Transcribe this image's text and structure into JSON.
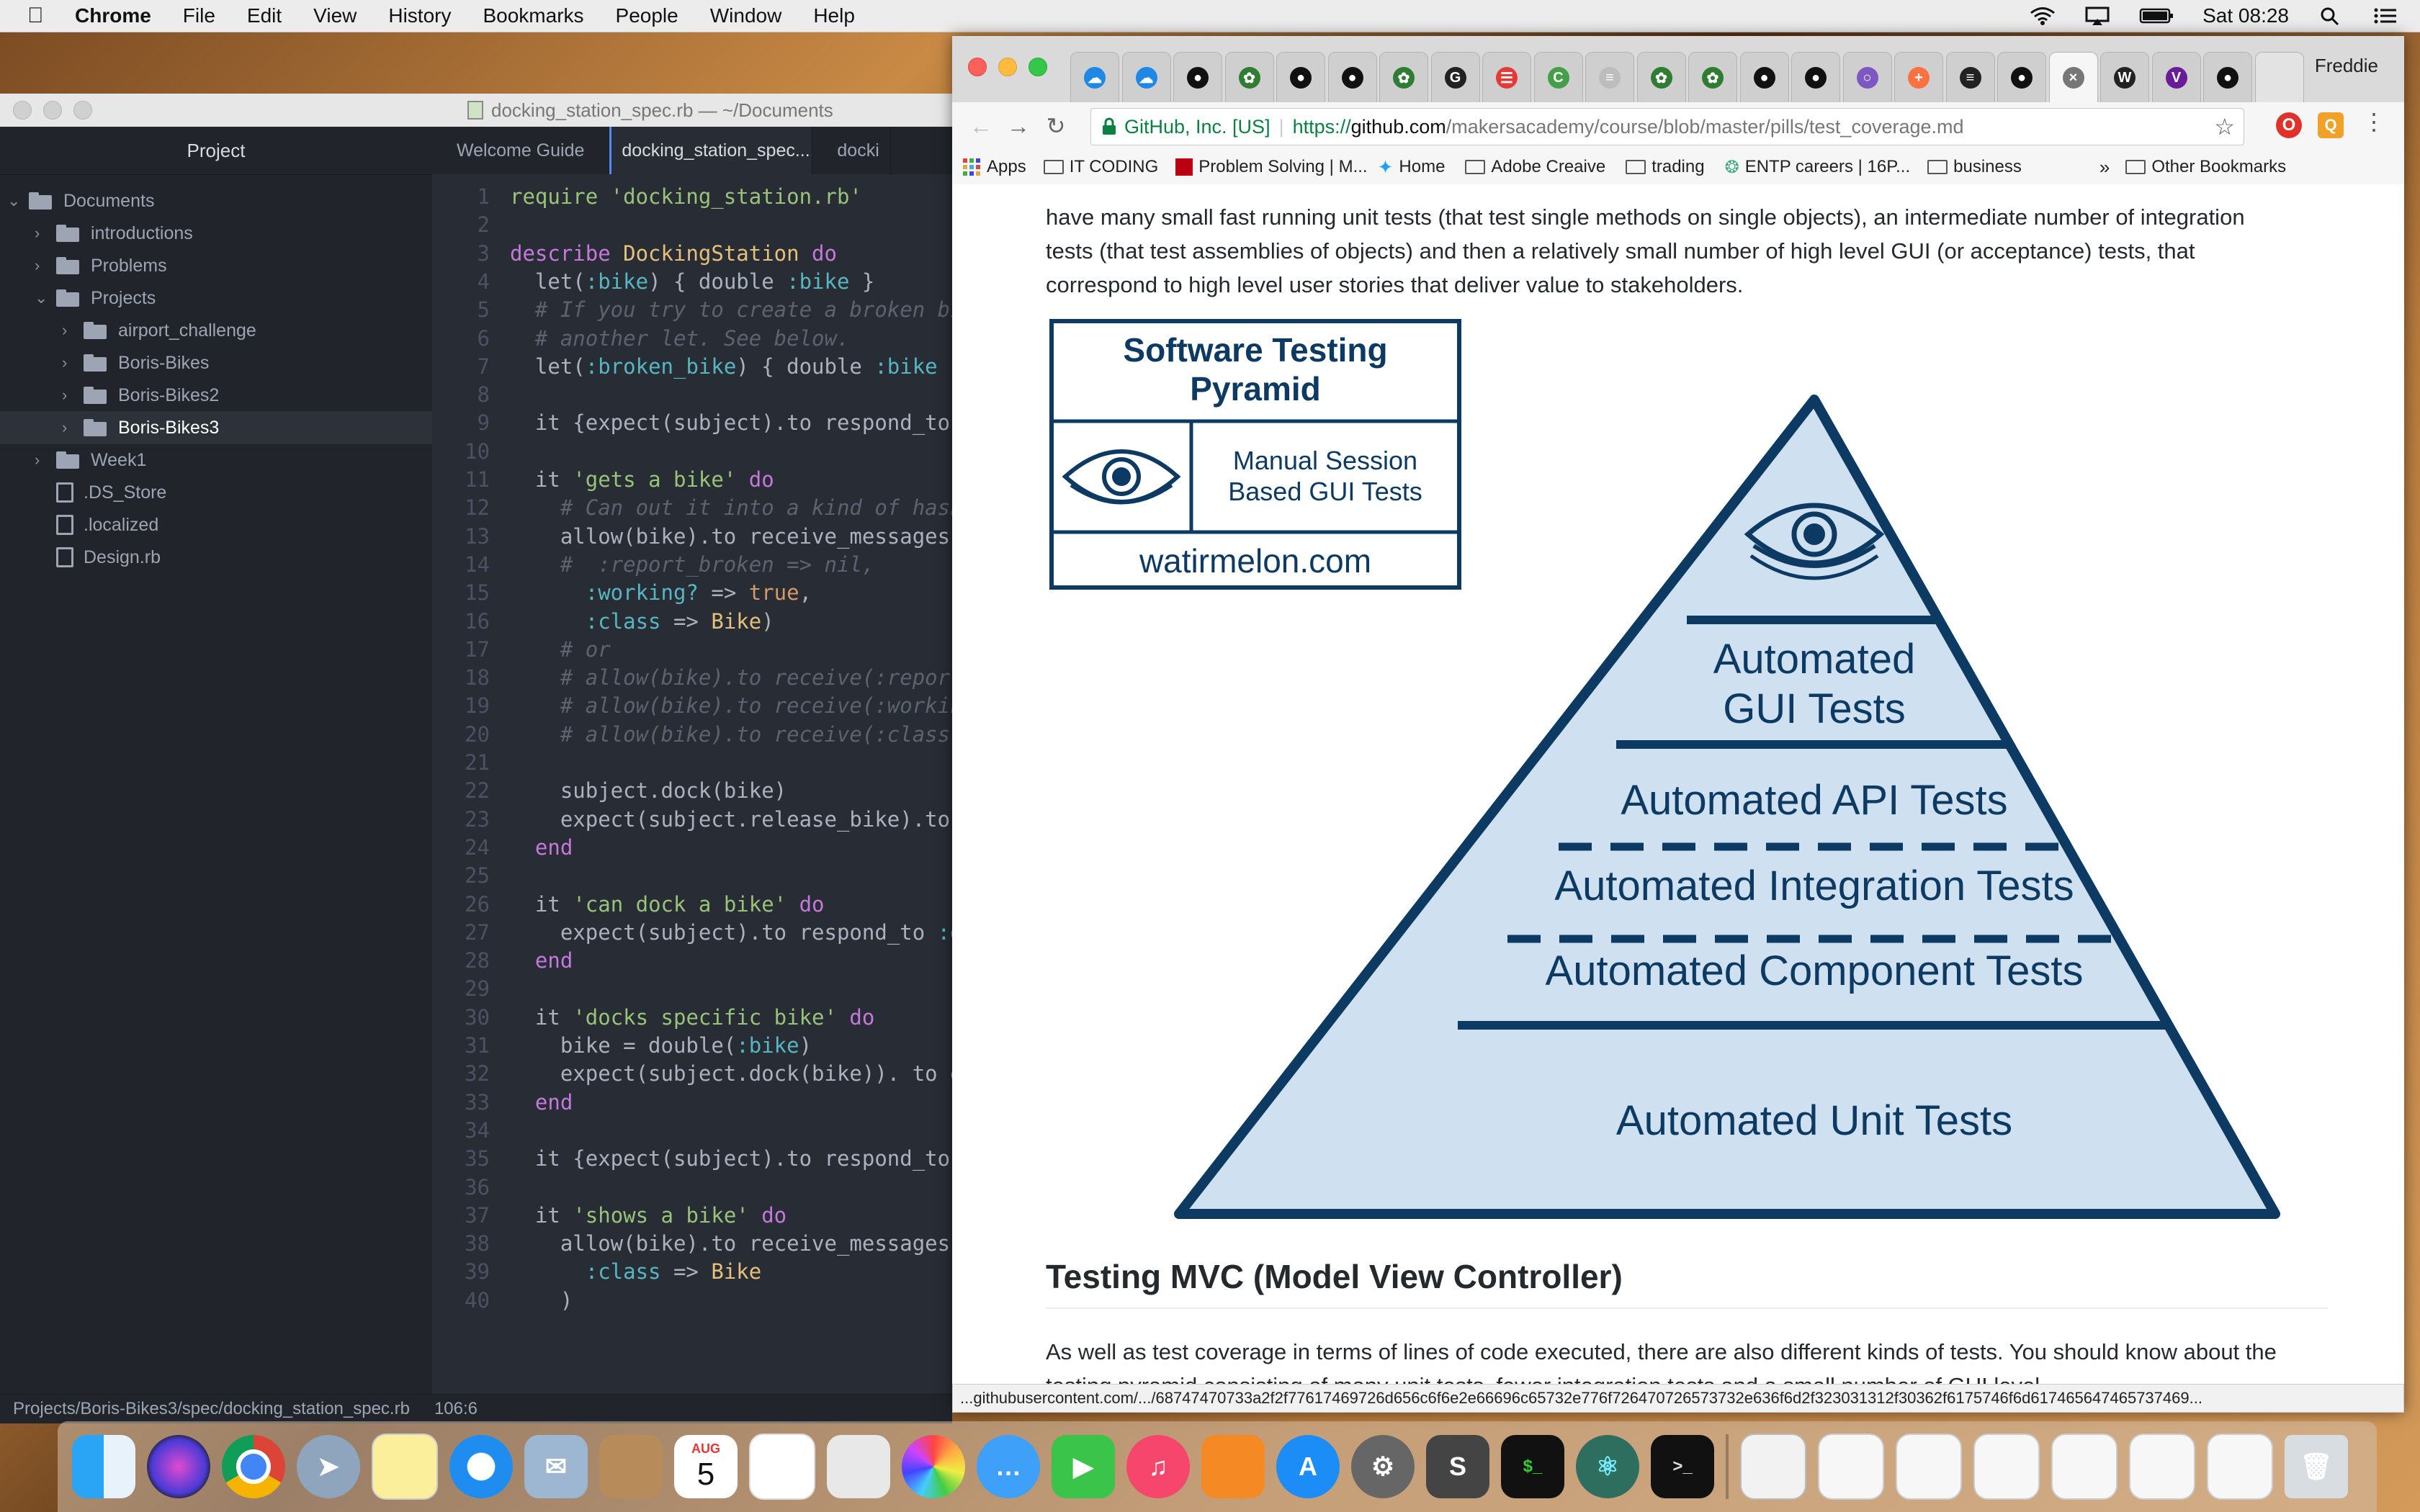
{
  "menubar": {
    "app": "Chrome",
    "items": [
      "File",
      "Edit",
      "View",
      "History",
      "Bookmarks",
      "People",
      "Window",
      "Help"
    ],
    "clock": "Sat 08:28"
  },
  "atom": {
    "title": "docking_station_spec.rb — ~/Documents",
    "tree_header": "Project",
    "tree": [
      {
        "label": "Documents",
        "kind": "folder",
        "state": "open"
      },
      {
        "label": "introductions",
        "kind": "folder",
        "state": "closed"
      },
      {
        "label": "Problems",
        "kind": "folder",
        "state": "closed"
      },
      {
        "label": "Projects",
        "kind": "folder",
        "state": "open"
      },
      {
        "label": "airport_challenge",
        "kind": "folder",
        "state": "closed"
      },
      {
        "label": "Boris-Bikes",
        "kind": "folder",
        "state": "closed"
      },
      {
        "label": "Boris-Bikes2",
        "kind": "folder",
        "state": "closed"
      },
      {
        "label": "Boris-Bikes3",
        "kind": "folder",
        "state": "selected"
      },
      {
        "label": "Week1",
        "kind": "folder",
        "state": "closed"
      },
      {
        "label": ".DS_Store",
        "kind": "file"
      },
      {
        "label": ".localized",
        "kind": "file"
      },
      {
        "label": "Design.rb",
        "kind": "file"
      }
    ],
    "tabs": [
      "Welcome Guide",
      "docking_station_spec....",
      "docki"
    ],
    "code": [
      [
        [
          "str",
          "require 'docking_station.rb'"
        ]
      ],
      [],
      [
        [
          "kw",
          "describe "
        ],
        [
          "cls",
          "DockingStation"
        ],
        [
          "kw",
          " do"
        ]
      ],
      [
        [
          "",
          "  let("
        ],
        [
          "sym",
          ":bike"
        ],
        [
          "",
          ") { double "
        ],
        [
          "sym",
          ":bike"
        ],
        [
          "",
          " }"
        ]
      ],
      [
        [
          "cmt",
          "  # If you try to create a broken bi"
        ]
      ],
      [
        [
          "cmt",
          "  # another let. See below."
        ]
      ],
      [
        [
          "",
          "  let("
        ],
        [
          "sym",
          ":broken_bike"
        ],
        [
          "",
          ") { double "
        ],
        [
          "sym",
          ":bike"
        ],
        [
          "",
          " }"
        ]
      ],
      [],
      [
        [
          "",
          "  it {expect(subject).to respond_to "
        ]
      ],
      [],
      [
        [
          "",
          "  it "
        ],
        [
          "str",
          "'gets a bike'"
        ],
        [
          "kw",
          " do"
        ]
      ],
      [
        [
          "cmt",
          "    # Can out it into a kind of hash"
        ]
      ],
      [
        [
          "",
          "    allow(bike).to receive_messages("
        ]
      ],
      [
        [
          "cmt",
          "    #  :report_broken => nil,"
        ]
      ],
      [
        [
          "sym",
          "      :working?"
        ],
        [
          "",
          " => "
        ],
        [
          "bool",
          "true"
        ],
        [
          "",
          ","
        ]
      ],
      [
        [
          "sym",
          "      :class"
        ],
        [
          "",
          " => "
        ],
        [
          "cls",
          "Bike"
        ],
        [
          "",
          ")"
        ]
      ],
      [
        [
          "cmt",
          "    # or"
        ]
      ],
      [
        [
          "cmt",
          "    # allow(bike).to receive(:report_"
        ]
      ],
      [
        [
          "cmt",
          "    # allow(bike).to receive(:working"
        ]
      ],
      [
        [
          "cmt",
          "    # allow(bike).to receive(:class)."
        ]
      ],
      [],
      [
        [
          "",
          "    subject.dock(bike)"
        ]
      ],
      [
        [
          "",
          "    expect(subject.release_bike).to b"
        ]
      ],
      [
        [
          "kw",
          "  end"
        ]
      ],
      [],
      [
        [
          "",
          "  it "
        ],
        [
          "str",
          "'can dock a bike'"
        ],
        [
          "kw",
          " do"
        ]
      ],
      [
        [
          "",
          "    expect(subject).to respond_to "
        ],
        [
          "sym",
          ":do"
        ]
      ],
      [
        [
          "kw",
          "  end"
        ]
      ],
      [],
      [
        [
          "",
          "  it "
        ],
        [
          "str",
          "'docks specific bike'"
        ],
        [
          "kw",
          " do"
        ]
      ],
      [
        [
          "",
          "    bike = double("
        ],
        [
          "sym",
          ":bike"
        ],
        [
          "",
          ")"
        ]
      ],
      [
        [
          "",
          "    expect(subject.dock(bike)). to eq"
        ]
      ],
      [
        [
          "kw",
          "  end"
        ]
      ],
      [],
      [
        [
          "",
          "  it {expect(subject).to respond_to "
        ]
      ],
      [],
      [
        [
          "",
          "  it "
        ],
        [
          "str",
          "'shows a bike'"
        ],
        [
          "kw",
          " do"
        ]
      ],
      [
        [
          "",
          "    allow(bike).to receive_messages("
        ]
      ],
      [
        [
          "sym",
          "      :class"
        ],
        [
          "",
          " => "
        ],
        [
          "cls",
          "Bike"
        ]
      ],
      [
        [
          "",
          "    )"
        ]
      ]
    ],
    "status_path": "Projects/Boris-Bikes3/spec/docking_station_spec.rb",
    "status_pos": "106:6"
  },
  "chrome": {
    "profile": "Freddie",
    "secure_label": "GitHub, Inc. [US]",
    "url_prefix": "https://",
    "url_domain": "github.com",
    "url_path": "/makersacademy/course/blob/master/pills/test_coverage.md",
    "bookmarks": [
      "Apps",
      "IT CODING",
      "Problem Solving | M...",
      "Home",
      "Adobe Creaive",
      "trading",
      "ENTP careers | 16P...",
      "business",
      "Other Bookmarks"
    ],
    "para1": "have many small fast running unit tests (that test single methods on single objects), an intermediate number of integration tests (that test assemblies of objects) and then a relatively small number of high level GUI (or acceptance) tests, that correspond to high level user stories that deliver value to stakeholders.",
    "pyramid": {
      "box_title": "Software Testing Pyramid",
      "box_title_1": "Software Testing",
      "box_title_2": "Pyramid",
      "manual_1": "Manual Session",
      "manual_2": "Based GUI Tests",
      "site": "watirmelon.com",
      "layer_gui_1": "Automated",
      "layer_gui_2": "GUI Tests",
      "layer_api": "Automated API Tests",
      "layer_integration": "Automated Integration Tests",
      "layer_component": "Automated Component Tests",
      "layer_unit": "Automated Unit Tests",
      "stroke_color": "#0d3a63",
      "fill_color": "#cfe0f1"
    },
    "heading": "Testing MVC (Model View Controller)",
    "para2": "As well as test coverage in terms of lines of code executed, there are also different kinds of tests. You should know about the testing pyramid consisting of many unit tests, fewer integration tests and a small number of GUI level",
    "status_url": "...githubusercontent.com/.../68747470733a2f2f77617469726d656c6f6e2e66696c65732e776f726470726573732e636f6d2f323031312f30362f6175746f6d617465647465737469..."
  },
  "dock": {
    "calendar_month": "AUG",
    "calendar_day": "5"
  }
}
